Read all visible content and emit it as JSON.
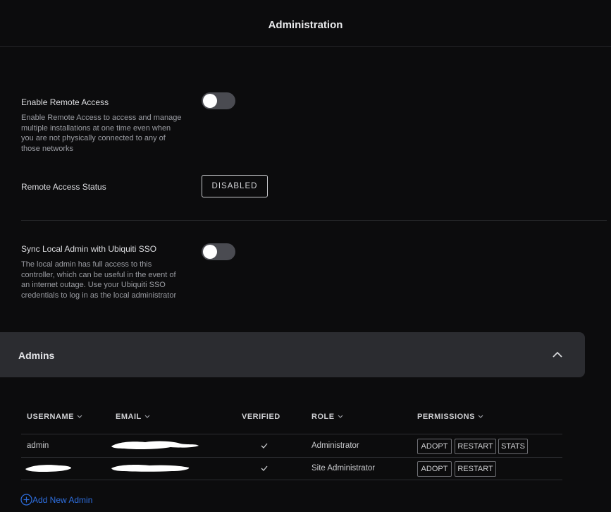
{
  "header": {
    "title": "Administration"
  },
  "remote_access": {
    "label": "Enable Remote Access",
    "description": "Enable Remote Access to access and manage multiple installations at one time even when you are not physically connected to any of those networks",
    "enabled": false
  },
  "remote_status": {
    "label": "Remote Access Status",
    "value": "DISABLED"
  },
  "sync_sso": {
    "label": "Sync Local Admin with Ubiquiti SSO",
    "description": "The local admin has full access to this controller, which can be useful in the event of an internet outage. Use your Ubiquiti SSO credentials to log in as the local administrator",
    "enabled": false
  },
  "admins": {
    "title": "Admins",
    "columns": {
      "username": "USERNAME",
      "email": "EMAIL",
      "verified": "VERIFIED",
      "role": "ROLE",
      "permissions": "PERMISSIONS"
    },
    "rows": [
      {
        "username": "admin",
        "role": "Administrator",
        "permissions": [
          "ADOPT",
          "RESTART",
          "STATS"
        ]
      },
      {
        "username": "",
        "role": "Site Administrator",
        "permissions": [
          "ADOPT",
          "RESTART"
        ]
      }
    ],
    "add_label": "Add New Admin"
  },
  "icons": {
    "caret": "chevron-down-icon",
    "collapse": "chevron-up-icon",
    "verified": "check-icon",
    "add": "plus-circle-icon"
  },
  "colors": {
    "accent": "#2e6fe0",
    "background": "#0c0c0d",
    "panel": "#2b2c30",
    "toggle_off": "#4a4b51"
  }
}
